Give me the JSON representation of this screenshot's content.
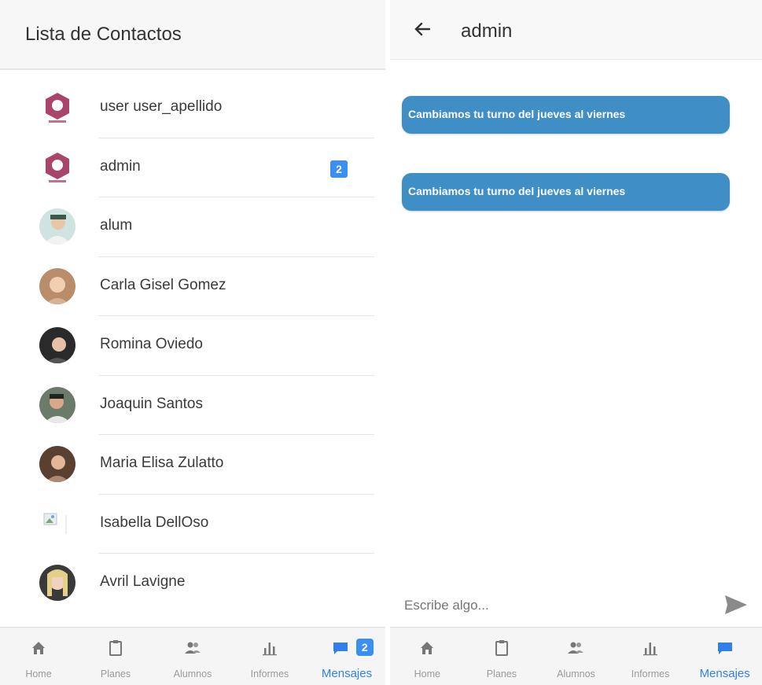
{
  "left": {
    "title": "Lista de Contactos",
    "contacts": [
      {
        "name": "user user_apellido",
        "avatar": "logo-avatar"
      },
      {
        "name": "admin",
        "avatar": "logo-avatar",
        "badge": "2"
      },
      {
        "name": "alum",
        "avatar": "photo-avatar"
      },
      {
        "name": "Carla Gisel Gomez",
        "avatar": "photo-avatar"
      },
      {
        "name": "Romina Oviedo",
        "avatar": "photo-avatar"
      },
      {
        "name": "Joaquin Santos",
        "avatar": "photo-avatar"
      },
      {
        "name": "Maria Elisa Zulatto",
        "avatar": "photo-avatar"
      },
      {
        "name": "Isabella DellOso",
        "avatar": "broken-image-avatar"
      },
      {
        "name": "Avril Lavigne",
        "avatar": "photo-avatar"
      }
    ],
    "tabs": [
      {
        "label": "Home",
        "icon": "home-icon"
      },
      {
        "label": "Planes",
        "icon": "clipboard-icon"
      },
      {
        "label": "Alumnos",
        "icon": "people-icon"
      },
      {
        "label": "Informes",
        "icon": "bar-chart-icon"
      },
      {
        "label": "Mensajes",
        "icon": "chat-icon",
        "badge": "2",
        "active": true
      }
    ]
  },
  "right": {
    "title": "admin",
    "messages": [
      {
        "text": "Cambiamos tu turno del jueves al viernes"
      },
      {
        "text": "Cambiamos tu turno del jueves al viernes"
      }
    ],
    "input_placeholder": "Escribe algo...",
    "tabs": [
      {
        "label": "Home",
        "icon": "home-icon"
      },
      {
        "label": "Planes",
        "icon": "clipboard-icon"
      },
      {
        "label": "Alumnos",
        "icon": "people-icon"
      },
      {
        "label": "Informes",
        "icon": "bar-chart-icon"
      },
      {
        "label": "Mensajes",
        "icon": "chat-icon",
        "active": true
      }
    ]
  },
  "colors": {
    "accent": "#2f80ed",
    "bubble": "#3f8ec6",
    "badge": "#3b8ff0",
    "tab_inactive": "#9a9a9a"
  }
}
